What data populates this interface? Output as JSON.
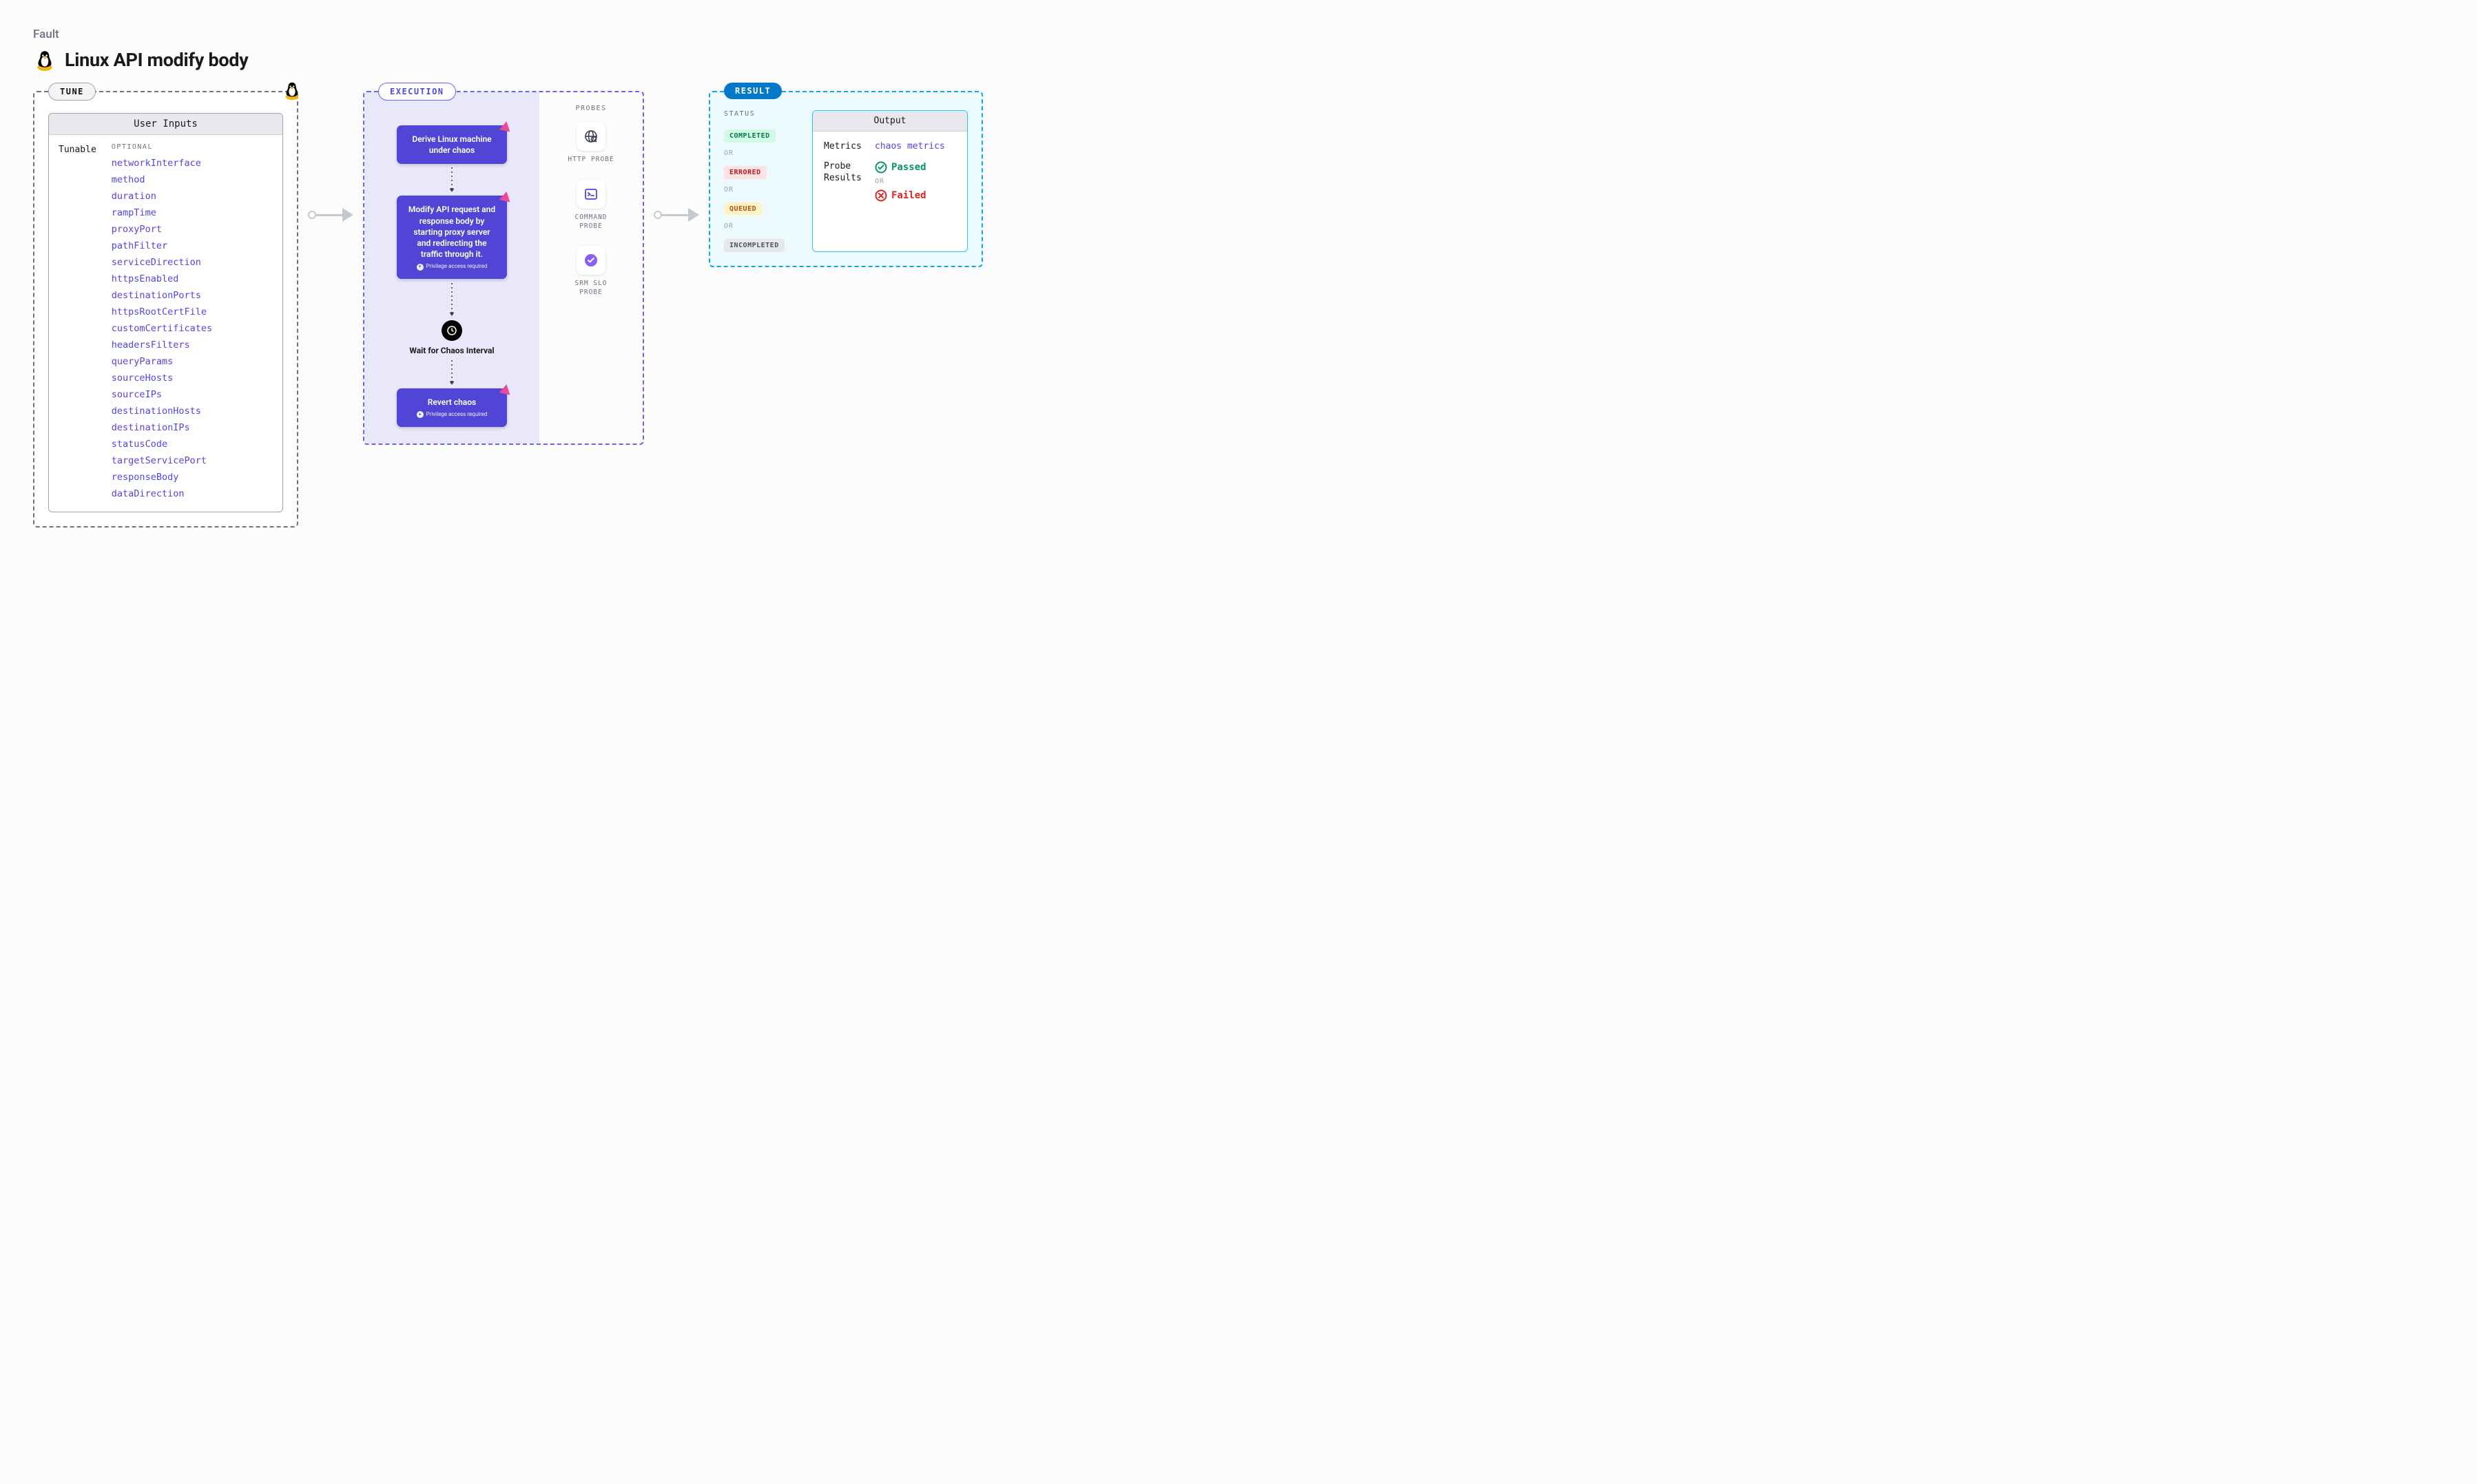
{
  "header": {
    "fault_label": "Fault",
    "title": "Linux API modify body"
  },
  "tune": {
    "label": "TUNE",
    "card_title": "User Inputs",
    "column_label": "Tunable",
    "optional_header": "OPTIONAL",
    "tunables": [
      "networkInterface",
      "method",
      "duration",
      "rampTime",
      "proxyPort",
      "pathFilter",
      "serviceDirection",
      "httpsEnabled",
      "destinationPorts",
      "httpsRootCertFile",
      "customCertificates",
      "headersFilters",
      "queryParams",
      "sourceHosts",
      "sourceIPs",
      "destinationHosts",
      "destinationIPs",
      "statusCode",
      "targetServicePort",
      "responseBody",
      "dataDirection"
    ]
  },
  "execution": {
    "label": "EXECUTION",
    "step1": "Derive Linux machine under chaos",
    "step2": "Modify API request and response body by starting proxy server and redirecting the traffic through it.",
    "privilege_note": "Privilege access required",
    "wait_label": "Wait for Chaos Interval",
    "step3": "Revert chaos",
    "probes_label": "PROBES",
    "probes": [
      {
        "name": "HTTP PROBE",
        "icon": "globe"
      },
      {
        "name": "COMMAND PROBE",
        "icon": "terminal"
      },
      {
        "name": "SRM SLO PROBE",
        "icon": "check-shield"
      }
    ]
  },
  "result": {
    "label": "RESULT",
    "status_label": "STATUS",
    "or_text": "OR",
    "statuses": [
      "COMPLETED",
      "ERRORED",
      "QUEUED",
      "INCOMPLETED"
    ],
    "output_title": "Output",
    "metrics_key": "Metrics",
    "metrics_link": "chaos metrics",
    "probe_results_key": "Probe Results",
    "passed": "Passed",
    "failed": "Failed"
  }
}
